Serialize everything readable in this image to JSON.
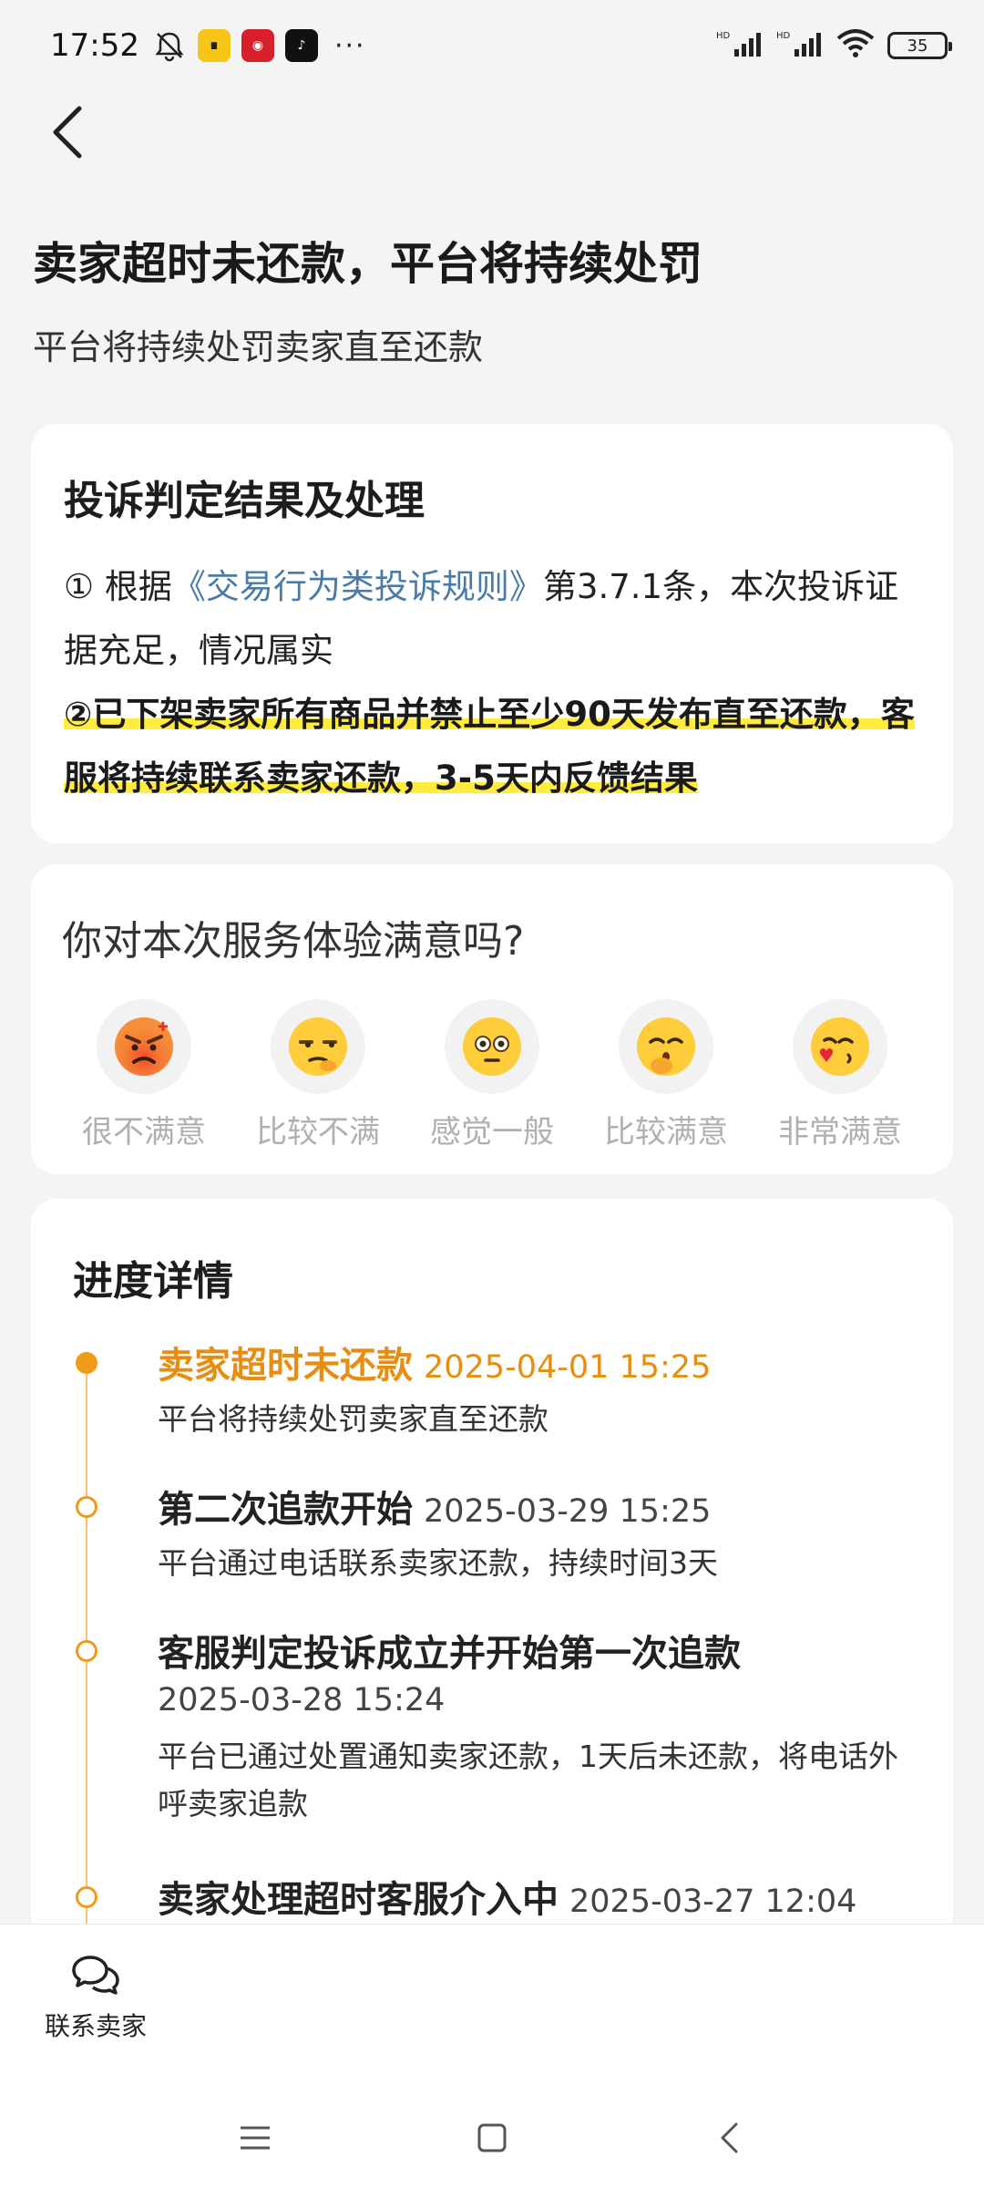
{
  "status_bar": {
    "time": "17:52",
    "apps": [
      "bell-off",
      "app-yellow",
      "app-red",
      "tiktok"
    ],
    "more": "···",
    "battery": "35"
  },
  "header": {
    "title": "卖家超时未还款，平台将持续处罚",
    "subtitle": "平台将持续处罚卖家直至还款"
  },
  "result_card": {
    "title": "投诉判定结果及处理",
    "line1_prefix": "① 根据",
    "line1_link": "《交易行为类投诉规则》",
    "line1_suffix": "第3.7.1条，本次投诉证据充足，情况属实",
    "line2": "②已下架卖家所有商品并禁止至少90天发布直至还款，客服将持续联系卖家还款，3-5天内反馈结果"
  },
  "survey": {
    "question": "你对本次服务体验满意吗?",
    "options": [
      {
        "label": "很不满意",
        "icon": "angry-face-icon"
      },
      {
        "label": "比较不满",
        "icon": "unamused-face-icon"
      },
      {
        "label": "感觉一般",
        "icon": "neutral-face-icon"
      },
      {
        "label": "比较满意",
        "icon": "shy-face-icon"
      },
      {
        "label": "非常满意",
        "icon": "kissing-face-icon"
      }
    ]
  },
  "progress": {
    "title": "进度详情",
    "steps": [
      {
        "title": "卖家超时未还款",
        "time": "2025-04-01 15:25",
        "desc": "平台将持续处罚卖家直至还款"
      },
      {
        "title": "第二次追款开始",
        "time": "2025-03-29 15:25",
        "desc": "平台通过电话联系卖家还款，持续时间3天"
      },
      {
        "title": "客服判定投诉成立并开始第一次追款",
        "time": "2025-03-28 15:24",
        "desc": "平台已通过处置通知卖家还款，1天后未还款，将电话外呼卖家追款"
      },
      {
        "title": "卖家处理超时客服介入中",
        "time": "2025-03-27 12:04",
        "desc": ""
      }
    ]
  },
  "bottom": {
    "contact_label": "联系卖家"
  },
  "colors": {
    "accent": "#e98d11",
    "highlight": "#ffec3d",
    "link": "#4a7aa8"
  }
}
